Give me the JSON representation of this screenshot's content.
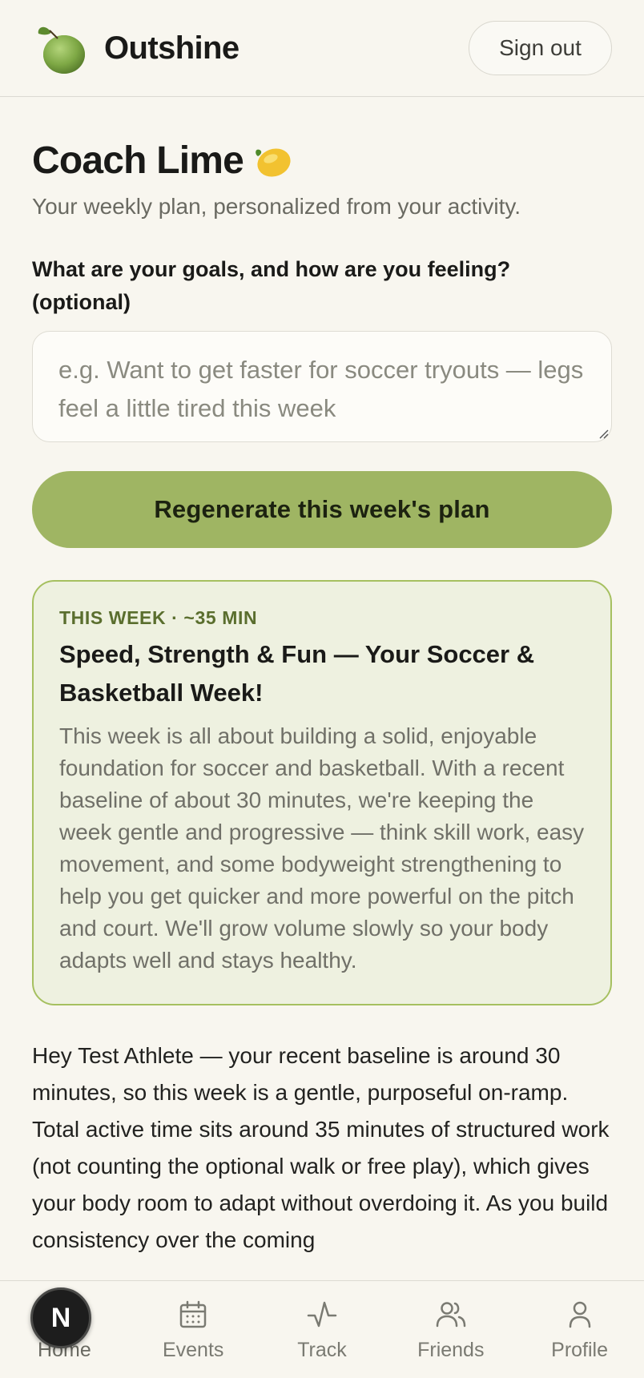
{
  "header": {
    "brand": "Outshine",
    "signout_label": "Sign out"
  },
  "coach": {
    "title": "Coach Lime",
    "subtitle": "Your weekly plan, personalized from your activity.",
    "goals_label": "What are your goals, and how are you feeling? (optional)",
    "goals_placeholder": "e.g. Want to get faster for soccer tryouts — legs feel a little tired this week",
    "regenerate_label": "Regenerate this week's plan"
  },
  "plan": {
    "meta": "THIS WEEK · ~35 MIN",
    "title": "Speed, Strength & Fun — Your Soccer & Basketball Week!",
    "description": "This week is all about building a solid, enjoyable foundation for soccer and basketball. With a recent baseline of about 30 minutes, we're keeping the week gentle and progressive — think skill work, easy movement, and some bodyweight strengthening to help you get quicker and more powerful on the pitch and court. We'll grow volume slowly so your body adapts well and stays healthy."
  },
  "coach_message": "Hey Test Athlete — your recent baseline is around 30 minutes, so this week is a gentle, purposeful on-ramp. Total active time sits around 35 minutes of structured work (not counting the optional walk or free play), which gives your body room to adapt without overdoing it. As you build consistency over the coming",
  "nav": {
    "items": [
      {
        "label": "Home",
        "icon": "home-icon"
      },
      {
        "label": "Events",
        "icon": "calendar-icon"
      },
      {
        "label": "Track",
        "icon": "activity-icon"
      },
      {
        "label": "Friends",
        "icon": "users-icon"
      },
      {
        "label": "Profile",
        "icon": "user-icon"
      }
    ],
    "badge": "N"
  },
  "colors": {
    "accent": "#9fb563",
    "card_border": "#a6c060",
    "card_bg": "#eef1e0",
    "background": "#f8f6ef"
  }
}
